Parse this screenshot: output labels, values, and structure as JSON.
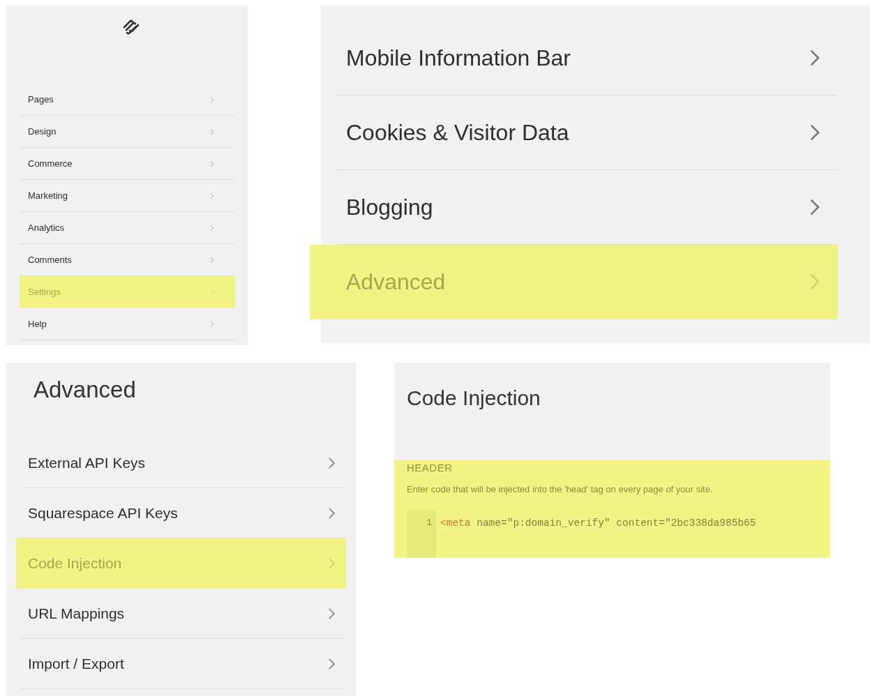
{
  "main_menu": {
    "items": [
      {
        "label": "Pages",
        "highlighted": false
      },
      {
        "label": "Design",
        "highlighted": false
      },
      {
        "label": "Commerce",
        "highlighted": false
      },
      {
        "label": "Marketing",
        "highlighted": false
      },
      {
        "label": "Analytics",
        "highlighted": false
      },
      {
        "label": "Comments",
        "highlighted": false
      },
      {
        "label": "Settings",
        "highlighted": true
      },
      {
        "label": "Help",
        "highlighted": false
      }
    ]
  },
  "settings_menu": {
    "items": [
      {
        "label": "Mobile Information Bar",
        "highlighted": false
      },
      {
        "label": "Cookies & Visitor Data",
        "highlighted": false
      },
      {
        "label": "Blogging",
        "highlighted": false
      },
      {
        "label": "Advanced",
        "highlighted": true
      }
    ]
  },
  "advanced_menu": {
    "title": "Advanced",
    "items": [
      {
        "label": "External API Keys",
        "highlighted": false
      },
      {
        "label": "Squarespace API Keys",
        "highlighted": false
      },
      {
        "label": "Code Injection",
        "highlighted": true
      },
      {
        "label": "URL Mappings",
        "highlighted": false
      },
      {
        "label": "Import / Export",
        "highlighted": false
      }
    ]
  },
  "code_injection": {
    "title": "Code Injection",
    "section": {
      "heading": "HEADER",
      "description": "Enter code that will be injected into the 'head' tag on every page of your site.",
      "highlighted": true,
      "lines": [
        {
          "number": "1",
          "tokens": [
            {
              "kind": "tag",
              "text": "<meta"
            },
            {
              "kind": "plain",
              "text": " name=\"p:domain_verify\" content=\"2bc338da985b65"
            }
          ]
        }
      ]
    }
  }
}
